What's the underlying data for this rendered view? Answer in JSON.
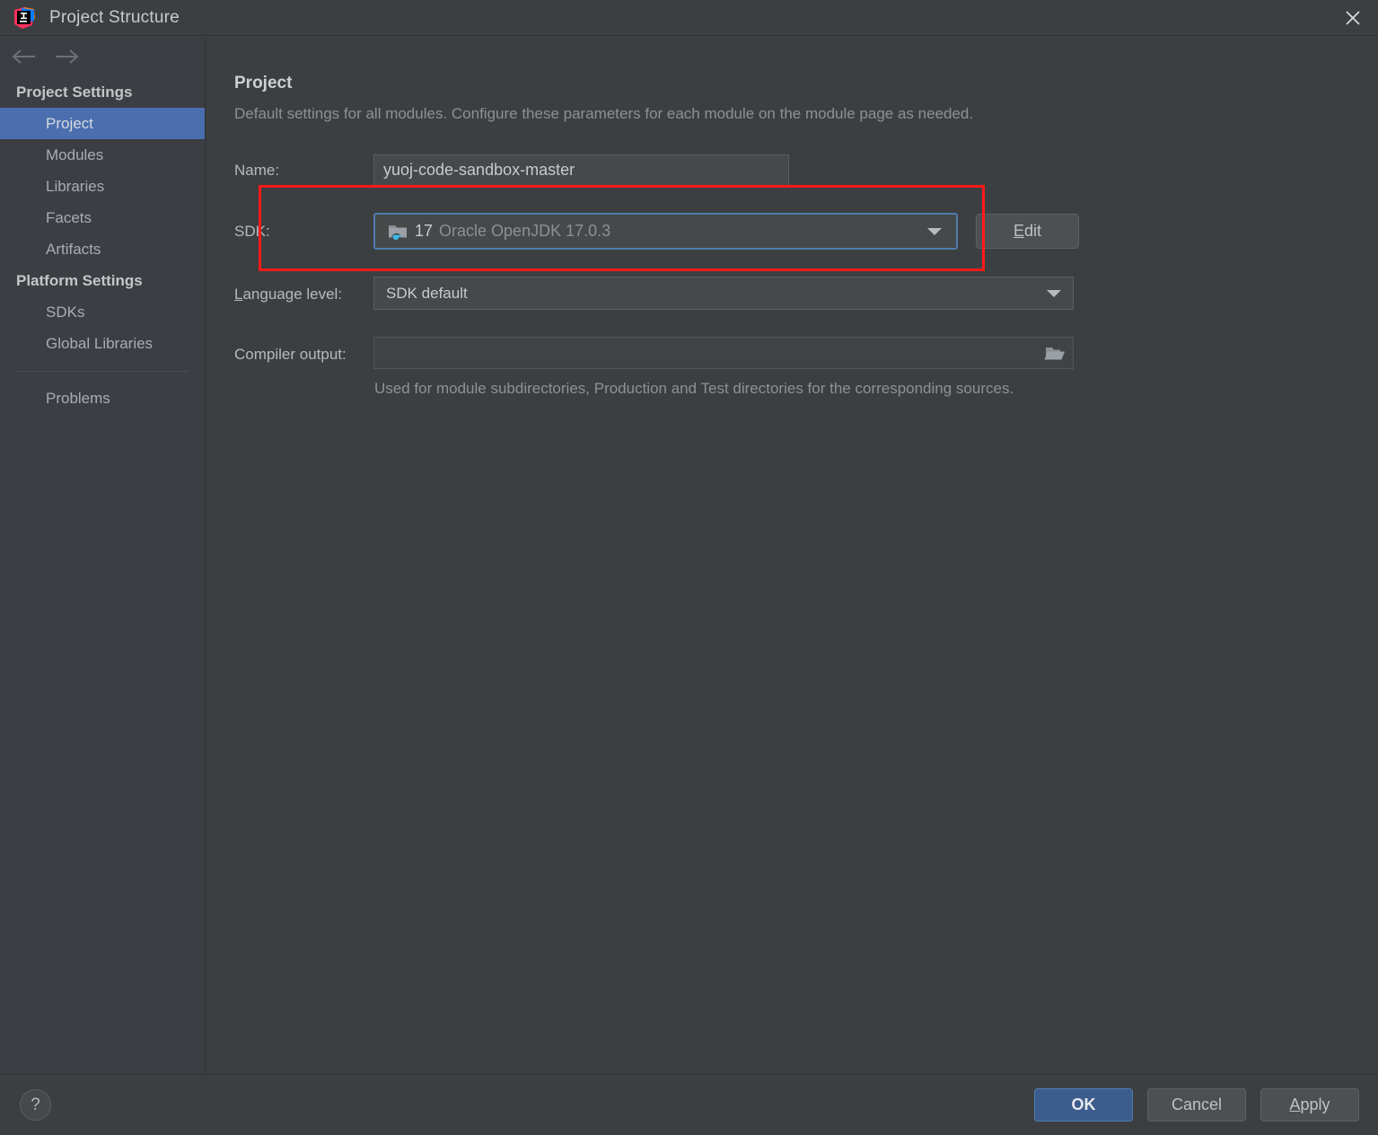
{
  "window": {
    "title": "Project Structure",
    "logo_icon": "intellij-idea-logo",
    "close_icon": "close-icon"
  },
  "nav": {
    "back_icon": "arrow-left-icon",
    "forward_icon": "arrow-right-icon"
  },
  "sidebar": {
    "groups": [
      {
        "title": "Project Settings",
        "items": [
          {
            "label": "Project",
            "selected": true
          },
          {
            "label": "Modules",
            "selected": false
          },
          {
            "label": "Libraries",
            "selected": false
          },
          {
            "label": "Facets",
            "selected": false
          },
          {
            "label": "Artifacts",
            "selected": false
          }
        ]
      },
      {
        "title": "Platform Settings",
        "items": [
          {
            "label": "SDKs",
            "selected": false
          },
          {
            "label": "Global Libraries",
            "selected": false
          }
        ]
      }
    ],
    "extra": {
      "label": "Problems"
    }
  },
  "main": {
    "title": "Project",
    "description": "Default settings for all modules. Configure these parameters for each module on the module page as needed.",
    "name_row": {
      "label": "Name:",
      "value": "yuoj-code-sandbox-master",
      "placeholder": ""
    },
    "sdk_row": {
      "label": "SDK:",
      "icon": "java-sdk-folder-icon",
      "version": "17",
      "name": "Oracle OpenJDK 17.0.3",
      "dropdown_icon": "chevron-down-icon",
      "edit_button": "Edit",
      "edit_button_mnemonic": "E"
    },
    "language_level_row": {
      "label": "Language level:",
      "label_mnemonic": "L",
      "value": "SDK default",
      "dropdown_icon": "chevron-down-icon"
    },
    "compiler_output_row": {
      "label": "Compiler output:",
      "value": "",
      "placeholder": "",
      "browse_icon": "folder-open-icon",
      "hint": "Used for module subdirectories, Production and Test directories for the corresponding sources."
    }
  },
  "annotation": {
    "highlight_color": "#ff1a1a",
    "target": "sdk-row"
  },
  "footer": {
    "help_label": "?",
    "help_icon": "help-icon",
    "ok_label": "OK",
    "cancel_label": "Cancel",
    "apply_label": "Apply",
    "apply_mnemonic": "A"
  },
  "colors": {
    "background": "#3c3f41",
    "sidebar": "#3b3e43",
    "selection": "#4b6eaf",
    "field": "#45494a",
    "focus_border": "#4e7dad",
    "accent_button": "#3b5c8d"
  }
}
